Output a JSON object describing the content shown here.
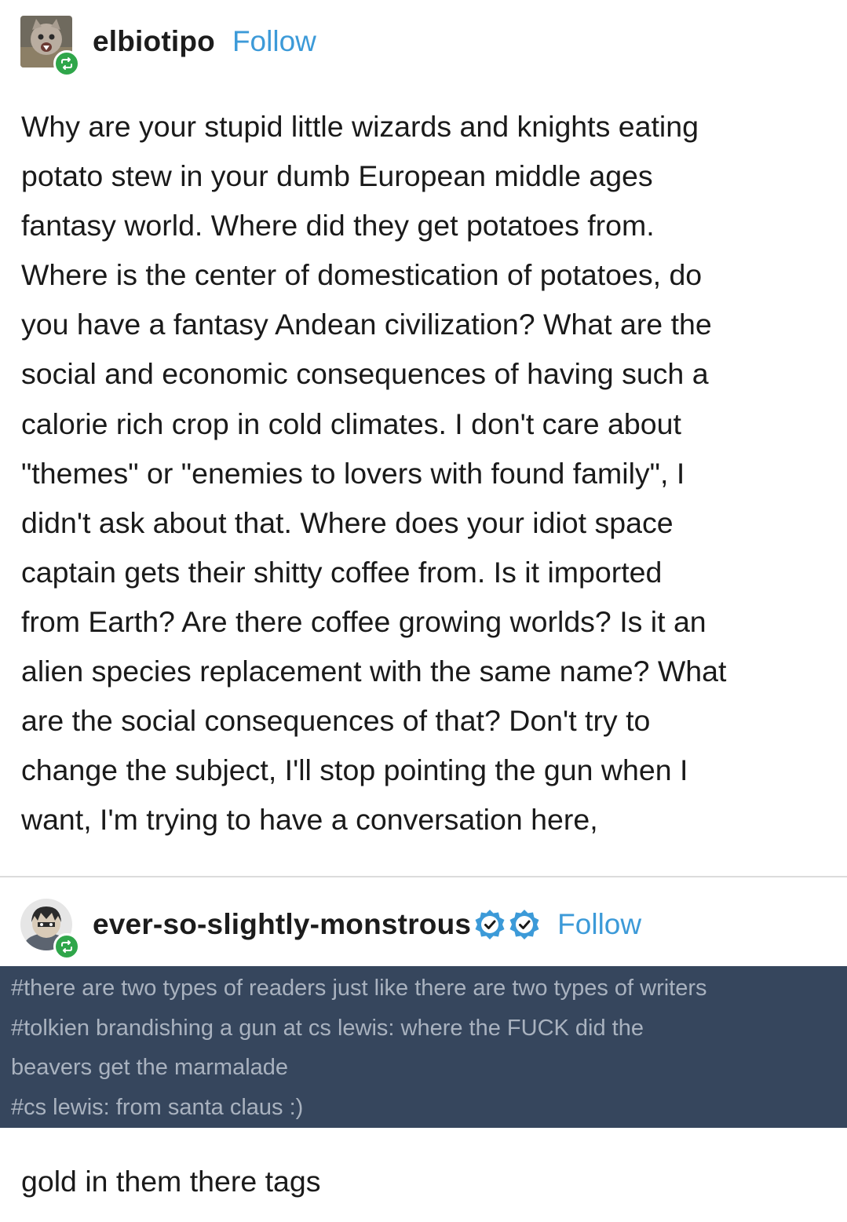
{
  "post1": {
    "username": "elbiotipo",
    "follow_label": "Follow",
    "avatar_icon": "cat-avatar",
    "badge_icon": "reblog-icon",
    "body_lines": [
      "Why are your stupid little wizards and knights eating",
      "potato stew in your dumb European middle ages",
      "fantasy world. Where did they get potatoes from.",
      "Where is the center of domestication of potatoes, do",
      "you have a fantasy Andean civilization? What are the",
      "social and economic consequences of having such a",
      "calorie rich crop in cold climates. I don't care about",
      "\"themes\" or \"enemies to lovers with found family\", I",
      "didn't ask about that. Where does your idiot space",
      "captain gets their shitty coffee from. Is it imported",
      "from Earth? Are there coffee growing worlds? Is it an",
      "alien species replacement with the same name? What",
      "are the social consequences of that? Don't try to",
      "change the subject, I'll stop pointing the gun when I",
      "want, I'm trying to have a conversation here,"
    ]
  },
  "post2": {
    "username": "ever-so-slightly-monstrous",
    "follow_label": "Follow",
    "avatar_icon": "cartoon-character-avatar",
    "badge_icon": "reblog-icon",
    "verified_icons": [
      "verified-checkmark-icon",
      "verified-checkmark-icon"
    ],
    "tag_lines": [
      "#there are two types of readers just like there are two types of writers",
      "#tolkien brandishing a gun at cs lewis: where the FUCK did the",
      "beavers get the marmalade",
      "#cs lewis: from santa claus :)"
    ],
    "reply": "gold in them there tags"
  },
  "colors": {
    "follow_link": "#3c9ad8",
    "reblog_badge": "#2fa64a",
    "verified_badge": "#3c9ad8",
    "tags_background": "#36465d",
    "tags_text": "#a9b2bf",
    "divider": "#dcdcdc"
  }
}
